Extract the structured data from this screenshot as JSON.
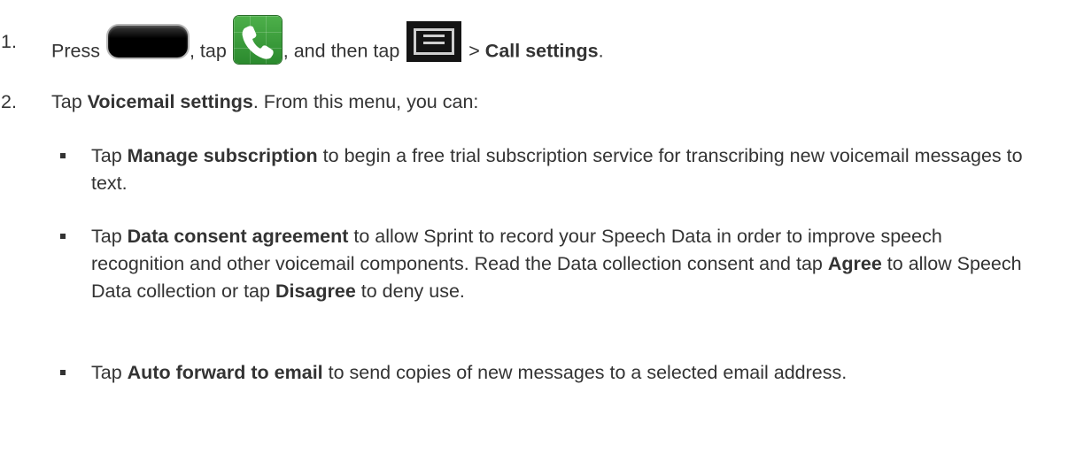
{
  "step1": {
    "number": "1.",
    "press": "Press",
    "tap_after_key": ", tap",
    "and_then_tap": ", and then tap",
    "gt": ">",
    "call_settings": "Call settings",
    "period": "."
  },
  "step2": {
    "number": "2.",
    "tap": "Tap",
    "voicemail_settings": "Voicemail settings",
    "rest": ". From this menu, you can:"
  },
  "bullets": [
    {
      "tap": "Tap",
      "term": "Manage subscription",
      "text": " to begin a free trial subscription service for transcribing new voicemail messages to text."
    },
    {
      "tap": "Tap",
      "term": "Data consent agreement",
      "text1": " to allow Sprint to record your Speech Data in order to improve speech recognition and other voicemail components. Read the Data collection consent and tap ",
      "agree": "Agree",
      "text2": " to allow Speech Data collection or tap ",
      "disagree": "Disagree",
      "text3": " to deny use."
    },
    {
      "tap": "Tap",
      "term": "Auto forward to email",
      "text": " to send copies of new messages to a selected email address."
    }
  ],
  "icons": {
    "home_key": "home-key-icon",
    "phone": "phone-app-icon",
    "menu": "menu-key-icon"
  },
  "colors": {
    "text": "#333333",
    "phone_icon_green": "#3f9f3d"
  }
}
